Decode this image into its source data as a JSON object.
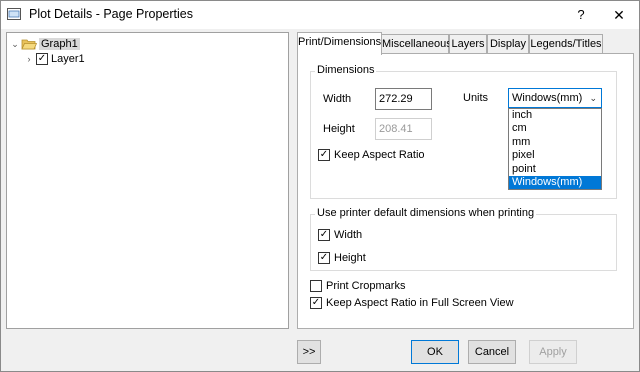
{
  "window": {
    "title": "Plot Details - Page Properties",
    "help_label": "?",
    "close_label": "✕"
  },
  "tree": {
    "items": [
      {
        "label": "Graph1",
        "expanded": true,
        "icon": "folder-open-icon",
        "selected": true
      },
      {
        "label": "Layer1",
        "checked": true
      }
    ]
  },
  "tabs": [
    {
      "label": "Print/Dimensions",
      "active": true
    },
    {
      "label": "Miscellaneous"
    },
    {
      "label": "Layers"
    },
    {
      "label": "Display"
    },
    {
      "label": "Legends/Titles"
    }
  ],
  "dimensions": {
    "group_title": "Dimensions",
    "width_label": "Width",
    "width_value": "272.29",
    "height_label": "Height",
    "height_value": "208.41",
    "keep_aspect_label": "Keep Aspect Ratio",
    "keep_aspect_checked": true,
    "units_label": "Units",
    "units_selected": "Windows(mm)",
    "units_options": [
      "inch",
      "cm",
      "mm",
      "pixel",
      "point",
      "Windows(mm)"
    ]
  },
  "printer": {
    "group_title": "Use printer default dimensions when printing",
    "width_label": "Width",
    "width_checked": true,
    "height_label": "Height",
    "height_checked": true
  },
  "options": {
    "print_cropmarks_label": "Print Cropmarks",
    "print_cropmarks_checked": false,
    "keep_aspect_fullscreen_label": "Keep Aspect Ratio in Full Screen View",
    "keep_aspect_fullscreen_checked": true
  },
  "buttons": {
    "expand_label": ">>",
    "ok_label": "OK",
    "cancel_label": "Cancel",
    "apply_label": "Apply"
  },
  "colors": {
    "accent": "#0078d7",
    "folder": "#e8c15a"
  }
}
